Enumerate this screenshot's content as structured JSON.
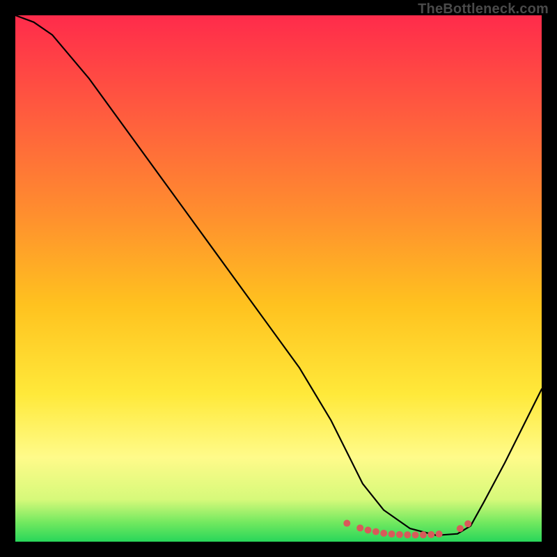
{
  "watermark": "TheBottleneck.com",
  "chart_data": {
    "type": "line",
    "title": "",
    "xlabel": "",
    "ylabel": "",
    "xlim": [
      0,
      100
    ],
    "ylim": [
      0,
      100
    ],
    "grid": false,
    "legend": false,
    "background_gradient": {
      "stops": [
        {
          "offset": 0.0,
          "color": "#ff2b4b"
        },
        {
          "offset": 0.18,
          "color": "#ff5a3f"
        },
        {
          "offset": 0.38,
          "color": "#ff8f2e"
        },
        {
          "offset": 0.55,
          "color": "#ffc21f"
        },
        {
          "offset": 0.72,
          "color": "#ffe93a"
        },
        {
          "offset": 0.84,
          "color": "#fffb8a"
        },
        {
          "offset": 0.92,
          "color": "#d6f97a"
        },
        {
          "offset": 0.965,
          "color": "#6fe85f"
        },
        {
          "offset": 1.0,
          "color": "#28d65a"
        }
      ]
    },
    "series": [
      {
        "name": "curve",
        "color": "#000000",
        "stroke_width": 2.2,
        "x": [
          0.0,
          3.5,
          7.0,
          14.0,
          22.0,
          30.0,
          38.0,
          46.0,
          54.0,
          60.0,
          63.5,
          66.0,
          70.0,
          75.0,
          80.0,
          84.0,
          86.5,
          89.0,
          93.0,
          97.0,
          100.0
        ],
        "y": [
          100.0,
          98.7,
          96.3,
          88.0,
          77.0,
          66.0,
          55.0,
          44.0,
          33.0,
          23.0,
          16.0,
          11.0,
          6.0,
          2.5,
          1.2,
          1.5,
          3.0,
          7.5,
          15.0,
          23.0,
          29.0
        ]
      }
    ],
    "markers": {
      "name": "flat-region-dots",
      "color": "#d85a5a",
      "radius": 5,
      "x": [
        63.0,
        65.5,
        67.0,
        68.5,
        70.0,
        71.5,
        73.0,
        74.5,
        76.0,
        77.5,
        79.0,
        80.5,
        84.5,
        86.0
      ],
      "y": [
        3.5,
        2.6,
        2.2,
        1.9,
        1.6,
        1.45,
        1.35,
        1.3,
        1.28,
        1.3,
        1.35,
        1.45,
        2.5,
        3.4
      ]
    }
  }
}
